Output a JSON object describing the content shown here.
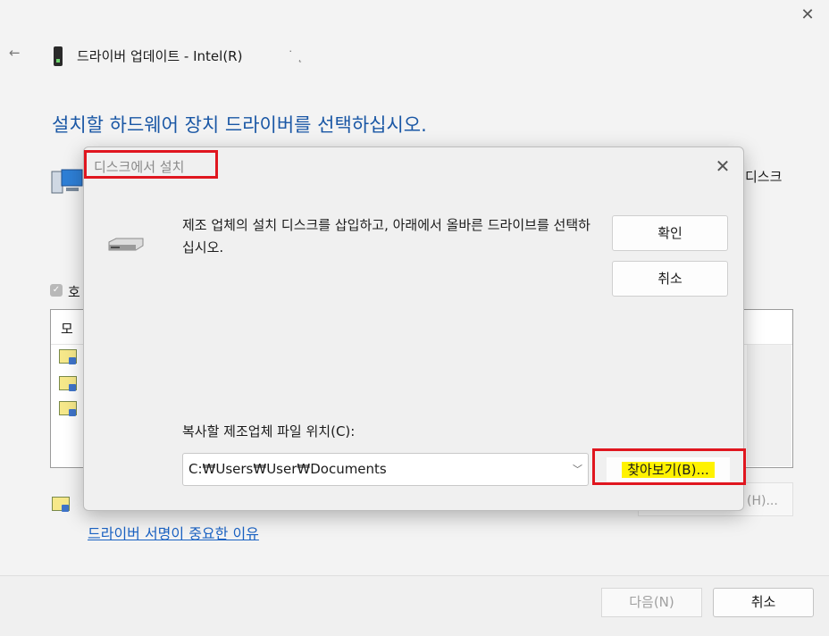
{
  "wizard": {
    "title": "드라이버 업데이트 - Intel(R)",
    "title_tail": "˙ ˛",
    "heading": "설치할 하드웨어 장치 드라이버를 선택하십시오.",
    "have_disk_partial": "디스크",
    "compat_label_partial": "호",
    "list_header_partial": "모",
    "have_disk_button_tail": "(H)...",
    "signing_link": "드라이버 서명이 중요한 이유",
    "next_button": "다음(N)",
    "cancel_button": "취소",
    "close_glyph": "✕",
    "back_glyph": "←"
  },
  "dialog": {
    "title": "디스크에서 설치",
    "close_glyph": "✕",
    "message": "제조 업체의 설치 디스크를 삽입하고, 아래에서 올바른 드라이브를 선택하십시오.",
    "ok_button": "확인",
    "cancel_button": "취소",
    "path_label": "복사할 제조업체 파일 위치(C):",
    "path_value": "C:₩Users₩User₩Documents",
    "browse_button": "찾아보기(B)..."
  },
  "colors": {
    "heading": "#1a57a5",
    "link": "#1a62c3",
    "highlight_box": "#e0161f",
    "browse_highlight": "#fff200"
  },
  "icons": [
    "back-arrow-icon",
    "device-icon",
    "computer-icon",
    "driver-icon",
    "drive-icon",
    "close-icon",
    "chevron-down-icon"
  ]
}
